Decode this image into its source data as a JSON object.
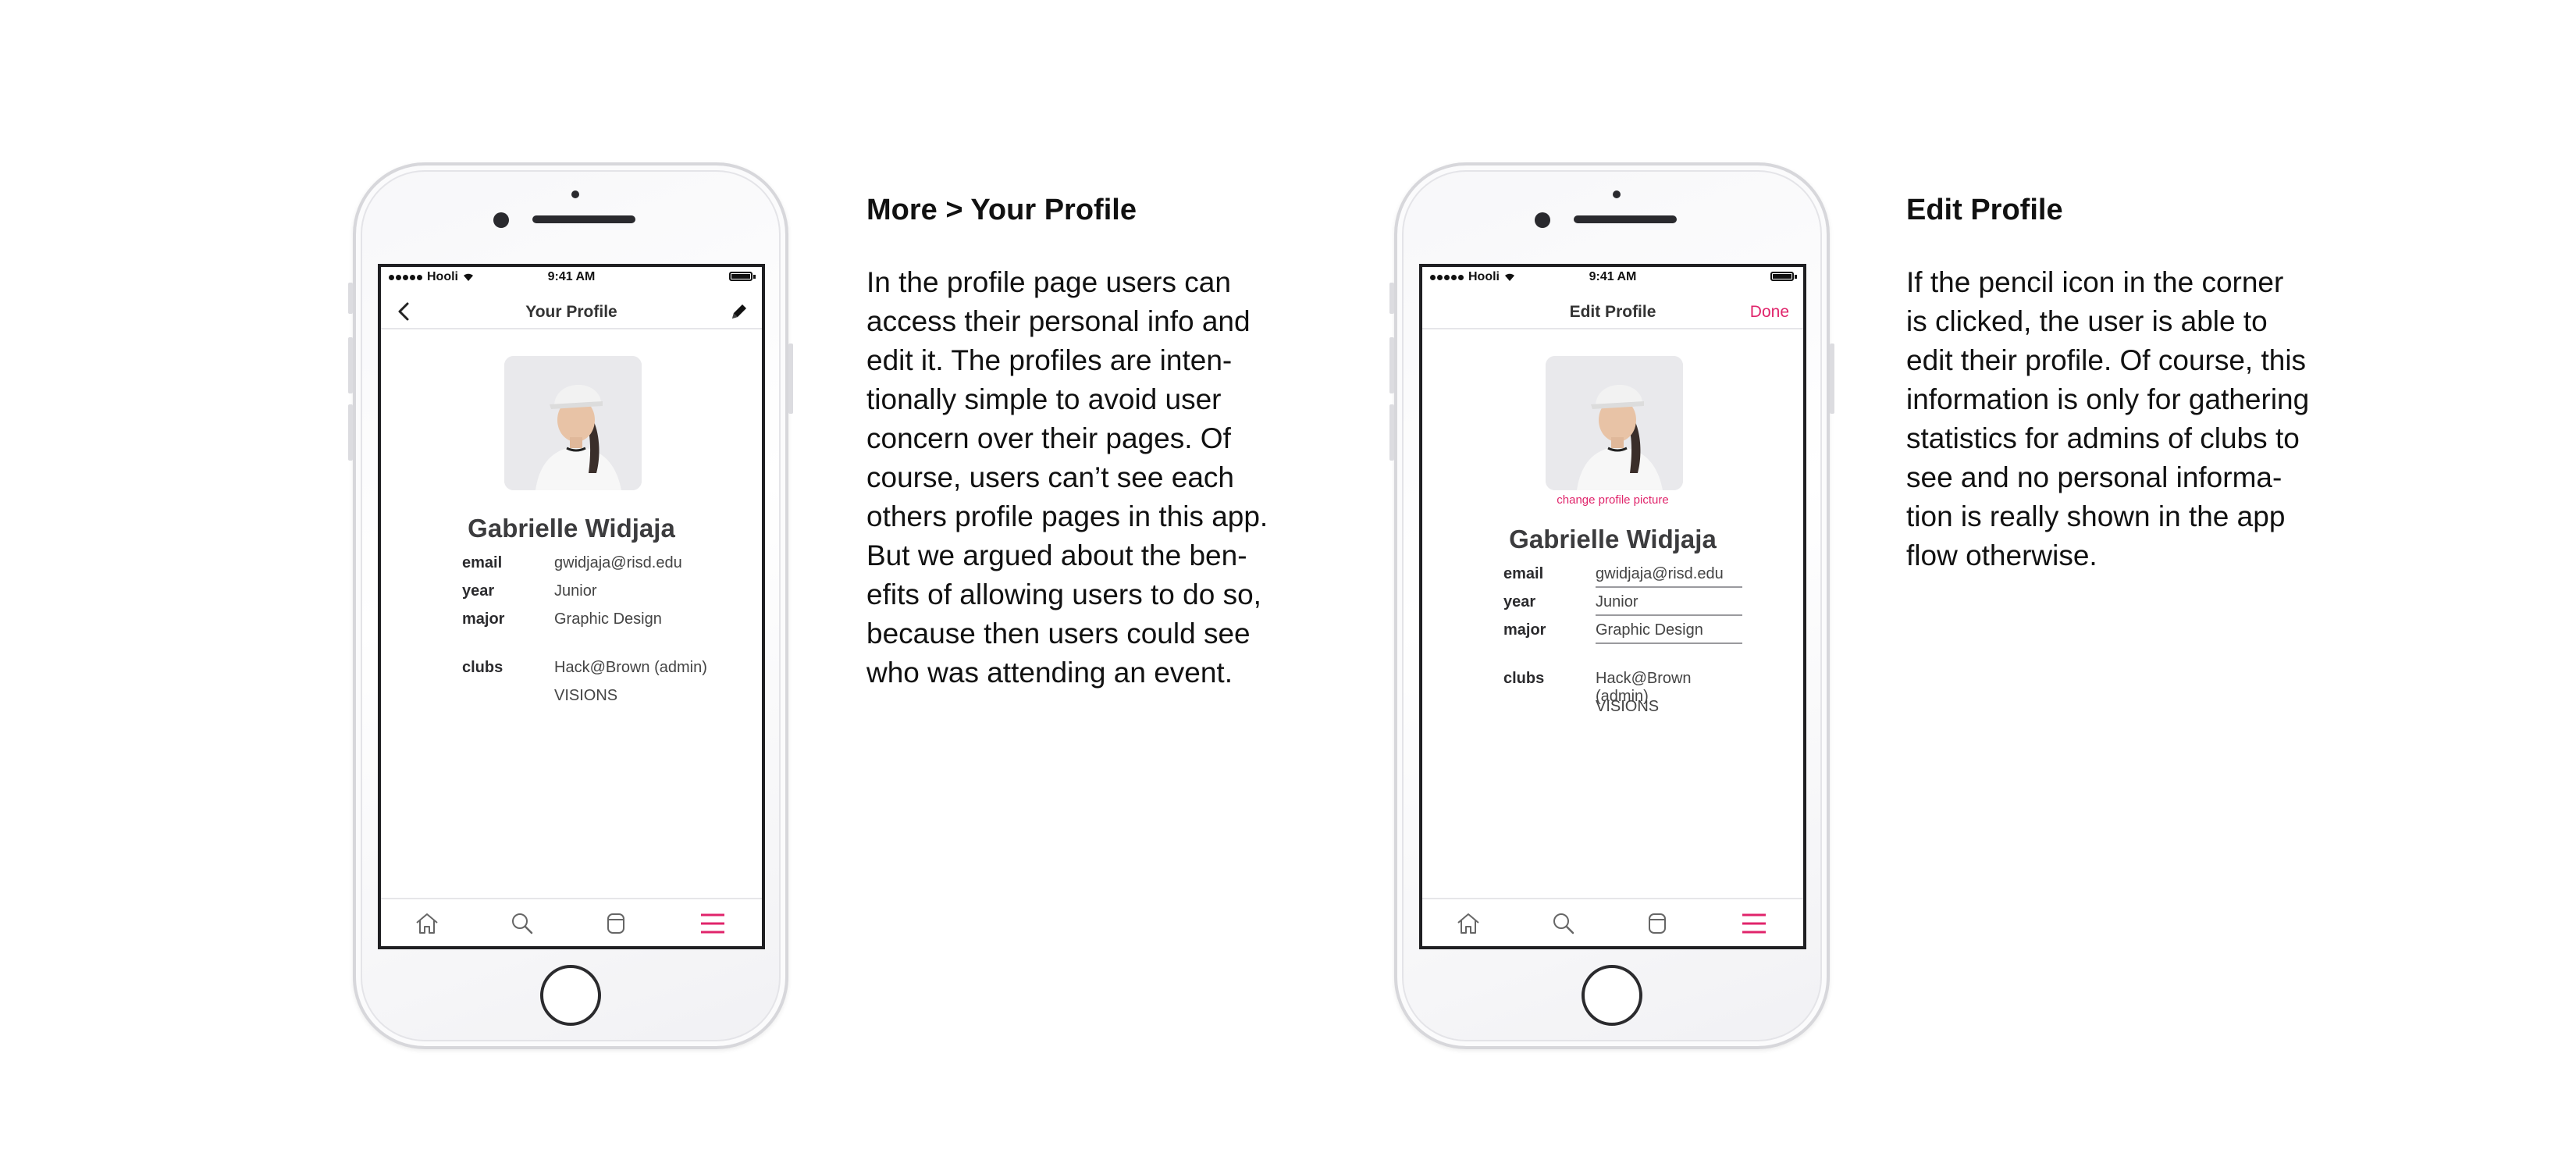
{
  "status_bar": {
    "carrier": "Hooli",
    "time": "9:41 AM"
  },
  "screen1": {
    "nav_title": "Your Profile",
    "name": "Gabrielle Widjaja",
    "info": [
      {
        "label": "email",
        "value": "gwidjaja@risd.edu"
      },
      {
        "label": "year",
        "value": "Junior"
      },
      {
        "label": "major",
        "value": "Graphic Design"
      },
      {
        "label": "clubs",
        "value": "Hack@Brown (admin)"
      },
      {
        "label": "",
        "value": "VISIONS"
      }
    ]
  },
  "screen2": {
    "nav_title": "Edit Profile",
    "done_label": "Done",
    "change_picture": "change profile picture",
    "name": "Gabrielle Widjaja",
    "info": [
      {
        "label": "email",
        "value": "gwidjaja@risd.edu"
      },
      {
        "label": "year",
        "value": "Junior"
      },
      {
        "label": "major",
        "value": "Graphic Design"
      },
      {
        "label": "clubs",
        "value": "Hack@Brown (admin)"
      },
      {
        "label": "",
        "value": "VISIONS"
      }
    ]
  },
  "tabbar": {
    "icons": [
      "home-icon",
      "search-icon",
      "events-icon",
      "menu-icon"
    ],
    "active_color": "#e0246b"
  },
  "description1": {
    "title": "More > Your Profile",
    "lines": [
      "In the profile page users can",
      "access their personal info and",
      "edit it. The profiles are inten-",
      "tionally simple to avoid user",
      "concern over their pages. Of",
      "course, users can’t see each",
      "others profile pages in this app.",
      "But we argued about the ben-",
      "efits of allowing users to do so,",
      "because then users could see",
      "who was attending an event."
    ]
  },
  "description2": {
    "title": "Edit Profile",
    "lines": [
      "If the pencil icon in the corner",
      "is clicked, the user is able to",
      "edit their profile. Of course, this",
      "information is only for gathering",
      "statistics for admins of clubs to",
      "see and no personal informa-",
      "tion is really shown in the app",
      "flow otherwise."
    ]
  }
}
